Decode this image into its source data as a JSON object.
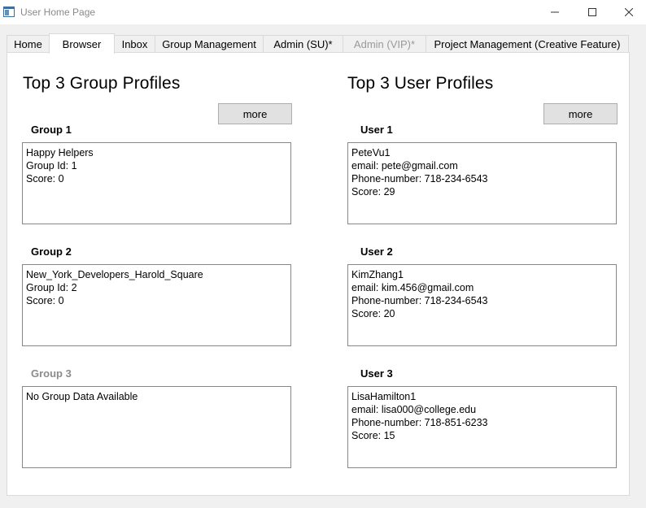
{
  "window": {
    "title": "User Home Page"
  },
  "tabs": [
    {
      "label": "Home",
      "state": "normal"
    },
    {
      "label": "Browser",
      "state": "active"
    },
    {
      "label": "Inbox",
      "state": "normal"
    },
    {
      "label": "Group Management",
      "state": "normal"
    },
    {
      "label": "Admin (SU)*",
      "state": "normal"
    },
    {
      "label": "Admin (VIP)*",
      "state": "disabled"
    },
    {
      "label": "Project Management (Creative Feature)",
      "state": "normal"
    }
  ],
  "groups_section": {
    "title": "Top 3 Group Profiles",
    "more_label": "more",
    "items": [
      {
        "label": "Group 1",
        "lines": [
          "Happy Helpers",
          "Group Id: 1",
          "Score: 0"
        ],
        "enabled": true
      },
      {
        "label": "Group 2",
        "lines": [
          "New_York_Developers_Harold_Square",
          "Group Id: 2",
          "Score: 0"
        ],
        "enabled": true
      },
      {
        "label": "Group 3",
        "lines": [
          "No Group Data Available"
        ],
        "enabled": false
      }
    ]
  },
  "users_section": {
    "title": "Top 3 User Profiles",
    "more_label": "more",
    "items": [
      {
        "label": "User 1",
        "lines": [
          "PeteVu1",
          "email: pete@gmail.com",
          "Phone-number: 718-234-6543",
          "Score: 29"
        ],
        "enabled": true
      },
      {
        "label": "User 2",
        "lines": [
          "KimZhang1",
          "email: kim.456@gmail.com",
          "Phone-number: 718-234-6543",
          "Score: 20"
        ],
        "enabled": true
      },
      {
        "label": "User 3",
        "lines": [
          "LisaHamilton1",
          "email: lisa000@college.edu",
          "Phone-number: 718-851-6233",
          "Score: 15"
        ],
        "enabled": true
      }
    ]
  },
  "icons": {
    "app": "window-app-icon",
    "minimize": "minimize-icon",
    "maximize": "maximize-icon",
    "close": "close-icon"
  },
  "colors": {
    "disabled_text": "#8c8c8c",
    "button_face": "#e1e1e1",
    "panel_background": "#ffffff"
  }
}
